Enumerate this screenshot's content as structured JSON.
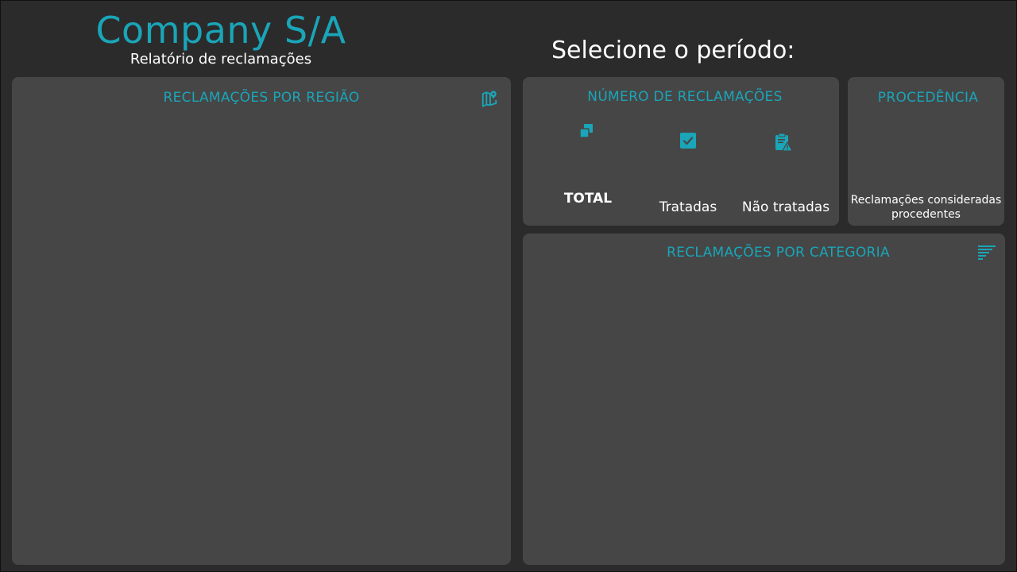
{
  "header": {
    "company": "Company S/A",
    "report": "Relatório de reclamações",
    "period_label": "Selecione o período:"
  },
  "cards": {
    "regiao": {
      "title": "RECLAMAÇÕES POR REGIÃO",
      "icon": "map-pin-icon"
    },
    "numero": {
      "title": "NÚMERO DE RECLAMAÇÕES",
      "items": [
        {
          "label": "TOTAL",
          "icon": "copy-icon"
        },
        {
          "label": "Tratadas",
          "icon": "check-box-icon"
        },
        {
          "label": "Não tratadas",
          "icon": "clipboard-warning-icon"
        }
      ]
    },
    "procedencia": {
      "title": "PROCEDÊNCIA",
      "description": "Reclamações consideradas procedentes"
    },
    "categoria": {
      "title": "RECLAMAÇÕES POR CATEGORIA",
      "icon": "sort-descending-icon"
    }
  },
  "colors": {
    "accent": "#1aa5b8",
    "background": "#2b2b2b",
    "card": "#464646",
    "text": "#ffffff"
  }
}
